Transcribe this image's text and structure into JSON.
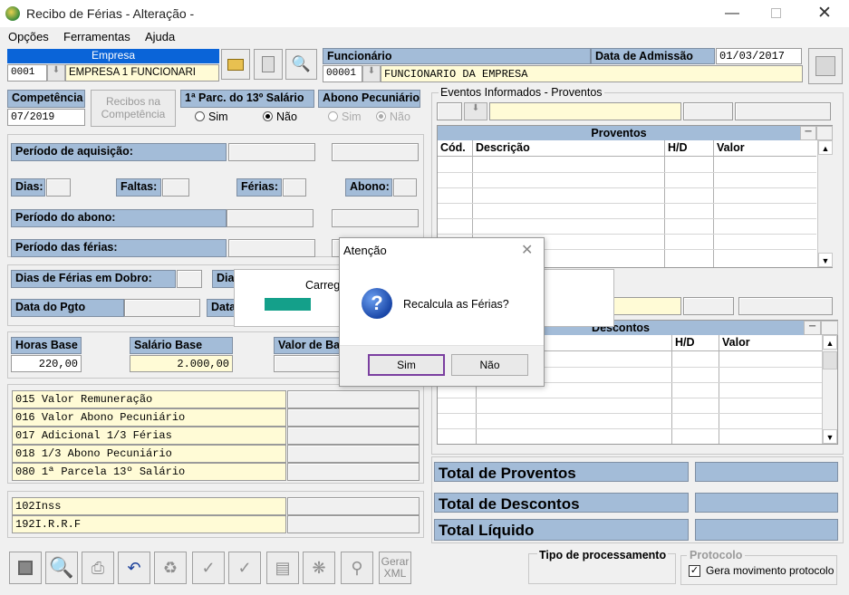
{
  "window": {
    "title": "Recibo de Férias - Alteração -"
  },
  "menu": [
    "Opções",
    "Ferramentas",
    "Ajuda"
  ],
  "empresa": {
    "header": "Empresa",
    "code": "0001",
    "name": "EMPRESA 1 FUNCIONARI"
  },
  "funcionario": {
    "label": "Funcionário",
    "code": "00001",
    "name": "FUNCIONARIO DA EMPRESA"
  },
  "admissao": {
    "label": "Data de Admissão",
    "value": "01/03/2017"
  },
  "competencia": {
    "label": "Competência",
    "value": "07/2019"
  },
  "recibos_btn": "Recibos na Competência",
  "parc13": {
    "label": "1ª Parc. do 13º Salário",
    "opt_sim": "Sim",
    "opt_nao": "Não"
  },
  "abono": {
    "label": "Abono Pecuniário",
    "opt_sim": "Sim",
    "opt_nao": "Não"
  },
  "fields": {
    "periodo_aquisicao": "Período de aquisição:",
    "dias": "Dias:",
    "faltas": "Faltas:",
    "ferias": "Férias:",
    "abono": "Abono:",
    "periodo_abono": "Período do abono:",
    "periodo_ferias": "Período das férias:",
    "dias_dobro": "Dias de Férias em Dobro:",
    "dias_dobro_2": "Dia",
    "data_pgto": "Data do Pgto",
    "data_pgto_2": "Data",
    "horas_base": "Horas Base",
    "horas_base_val": "220,00",
    "salario_base": "Salário Base",
    "salario_base_val": "2.000,00",
    "valor_base": "Valor de Ba"
  },
  "rubricas": [
    {
      "code": "015",
      "desc": "Valor Remuneração"
    },
    {
      "code": "016",
      "desc": "Valor Abono Pecuniário"
    },
    {
      "code": "017",
      "desc": "Adicional 1/3 Férias"
    },
    {
      "code": "018",
      "desc": "1/3 Abono Pecuniário"
    },
    {
      "code": "080",
      "desc": "1ª Parcela 13º Salário"
    }
  ],
  "descontos_rubricas": [
    {
      "code": "102",
      "desc": "Inss"
    },
    {
      "code": "192",
      "desc": "I.R.R.F"
    }
  ],
  "eventos": {
    "group_label": "Eventos Informados - Proventos"
  },
  "proventos_grid": {
    "title": "Proventos",
    "cols": [
      "Cód.",
      "Descrição",
      "H/D",
      "Valor"
    ]
  },
  "descontos_grid": {
    "title": "Descontos",
    "cols": [
      "H/D",
      "Valor"
    ]
  },
  "totals": {
    "proventos": "Total de Proventos",
    "descontos": "Total de Descontos",
    "liquido": "Total Líquido"
  },
  "tipo_processamento": "Tipo de processamento",
  "protocolo": {
    "group": "Protocolo",
    "checkbox": "Gera movimento protocolo",
    "checked": true
  },
  "toolbar": {
    "gerar_xml_1": "Gerar",
    "gerar_xml_2": "XML"
  },
  "loading": {
    "text": "Carreg"
  },
  "dialog": {
    "title": "Atenção",
    "message": "Recalcula as Férias?",
    "yes": "Sim",
    "no": "Não"
  }
}
